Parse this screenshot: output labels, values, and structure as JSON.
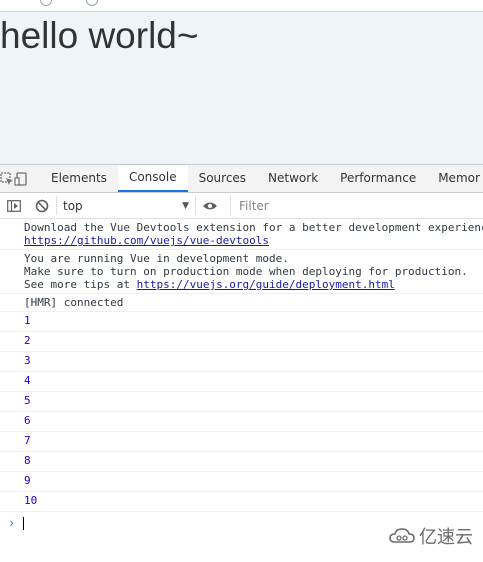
{
  "page": {
    "heading": "hello world~"
  },
  "devtools": {
    "tabs": [
      "Elements",
      "Console",
      "Sources",
      "Network",
      "Performance",
      "Memor"
    ],
    "active_tab": "Console",
    "context": "top",
    "filter_placeholder": "Filter",
    "accent_color": "#1a73e8"
  },
  "console": {
    "messages": [
      {
        "lines": [
          "Download the Vue Devtools extension for a better development experienc"
        ],
        "link": "https://github.com/vuejs/vue-devtools"
      },
      {
        "lines": [
          "You are running Vue in development mode.",
          "Make sure to turn on production mode when deploying for production."
        ],
        "prefix": "See more tips at ",
        "link": "https://vuejs.org/guide/deployment.html"
      },
      {
        "lines": [
          "[HMR] connected"
        ]
      }
    ],
    "numbers": [
      "1",
      "2",
      "3",
      "4",
      "5",
      "6",
      "7",
      "8",
      "9",
      "10"
    ]
  },
  "watermark": {
    "text": "亿速云",
    "icon": "cloud-logo-icon"
  }
}
